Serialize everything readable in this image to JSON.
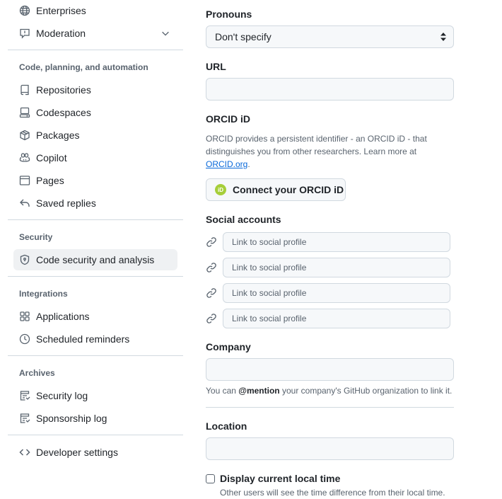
{
  "sidebar": {
    "top_items": [
      {
        "label": "Enterprises",
        "icon": "globe-icon"
      },
      {
        "label": "Moderation",
        "icon": "report-icon"
      }
    ],
    "groups": [
      {
        "title": "Code, planning, and automation",
        "items": [
          {
            "label": "Repositories",
            "icon": "repo-icon"
          },
          {
            "label": "Codespaces",
            "icon": "codespaces-icon"
          },
          {
            "label": "Packages",
            "icon": "package-icon"
          },
          {
            "label": "Copilot",
            "icon": "copilot-icon"
          },
          {
            "label": "Pages",
            "icon": "browser-icon"
          },
          {
            "label": "Saved replies",
            "icon": "reply-icon"
          }
        ]
      },
      {
        "title": "Security",
        "items": [
          {
            "label": "Code security and analysis",
            "icon": "shield-lock-icon",
            "active": true
          }
        ]
      },
      {
        "title": "Integrations",
        "items": [
          {
            "label": "Applications",
            "icon": "apps-icon"
          },
          {
            "label": "Scheduled reminders",
            "icon": "clock-icon"
          }
        ]
      },
      {
        "title": "Archives",
        "items": [
          {
            "label": "Security log",
            "icon": "log-icon"
          },
          {
            "label": "Sponsorship log",
            "icon": "log-icon"
          }
        ]
      }
    ],
    "developer_settings": {
      "label": "Developer settings",
      "icon": "code-icon"
    }
  },
  "form": {
    "pronouns": {
      "label": "Pronouns",
      "value": "Don't specify"
    },
    "url": {
      "label": "URL",
      "value": ""
    },
    "orcid": {
      "label": "ORCID iD",
      "desc_prefix": "ORCID provides a persistent identifier - an ORCID iD - that distinguishes you from other researchers. Learn more at ",
      "link_text": "ORCID.org",
      "desc_suffix": ".",
      "button": "Connect your ORCID iD",
      "logo_text": "iD"
    },
    "social": {
      "label": "Social accounts",
      "placeholders": [
        "Link to social profile",
        "Link to social profile",
        "Link to social profile",
        "Link to social profile"
      ]
    },
    "company": {
      "label": "Company",
      "value": "",
      "hint_prefix": "You can ",
      "hint_mention": "@mention",
      "hint_suffix": " your company's GitHub organization to link it."
    },
    "location": {
      "label": "Location",
      "value": ""
    },
    "local_time": {
      "label": "Display current local time",
      "hint": "Other users will see the time difference from their local time.",
      "checked": false
    }
  },
  "colors": {
    "accent": "#0969da",
    "border": "#d1d9e0",
    "muted": "#59636e",
    "orcid": "#a6ce39"
  }
}
